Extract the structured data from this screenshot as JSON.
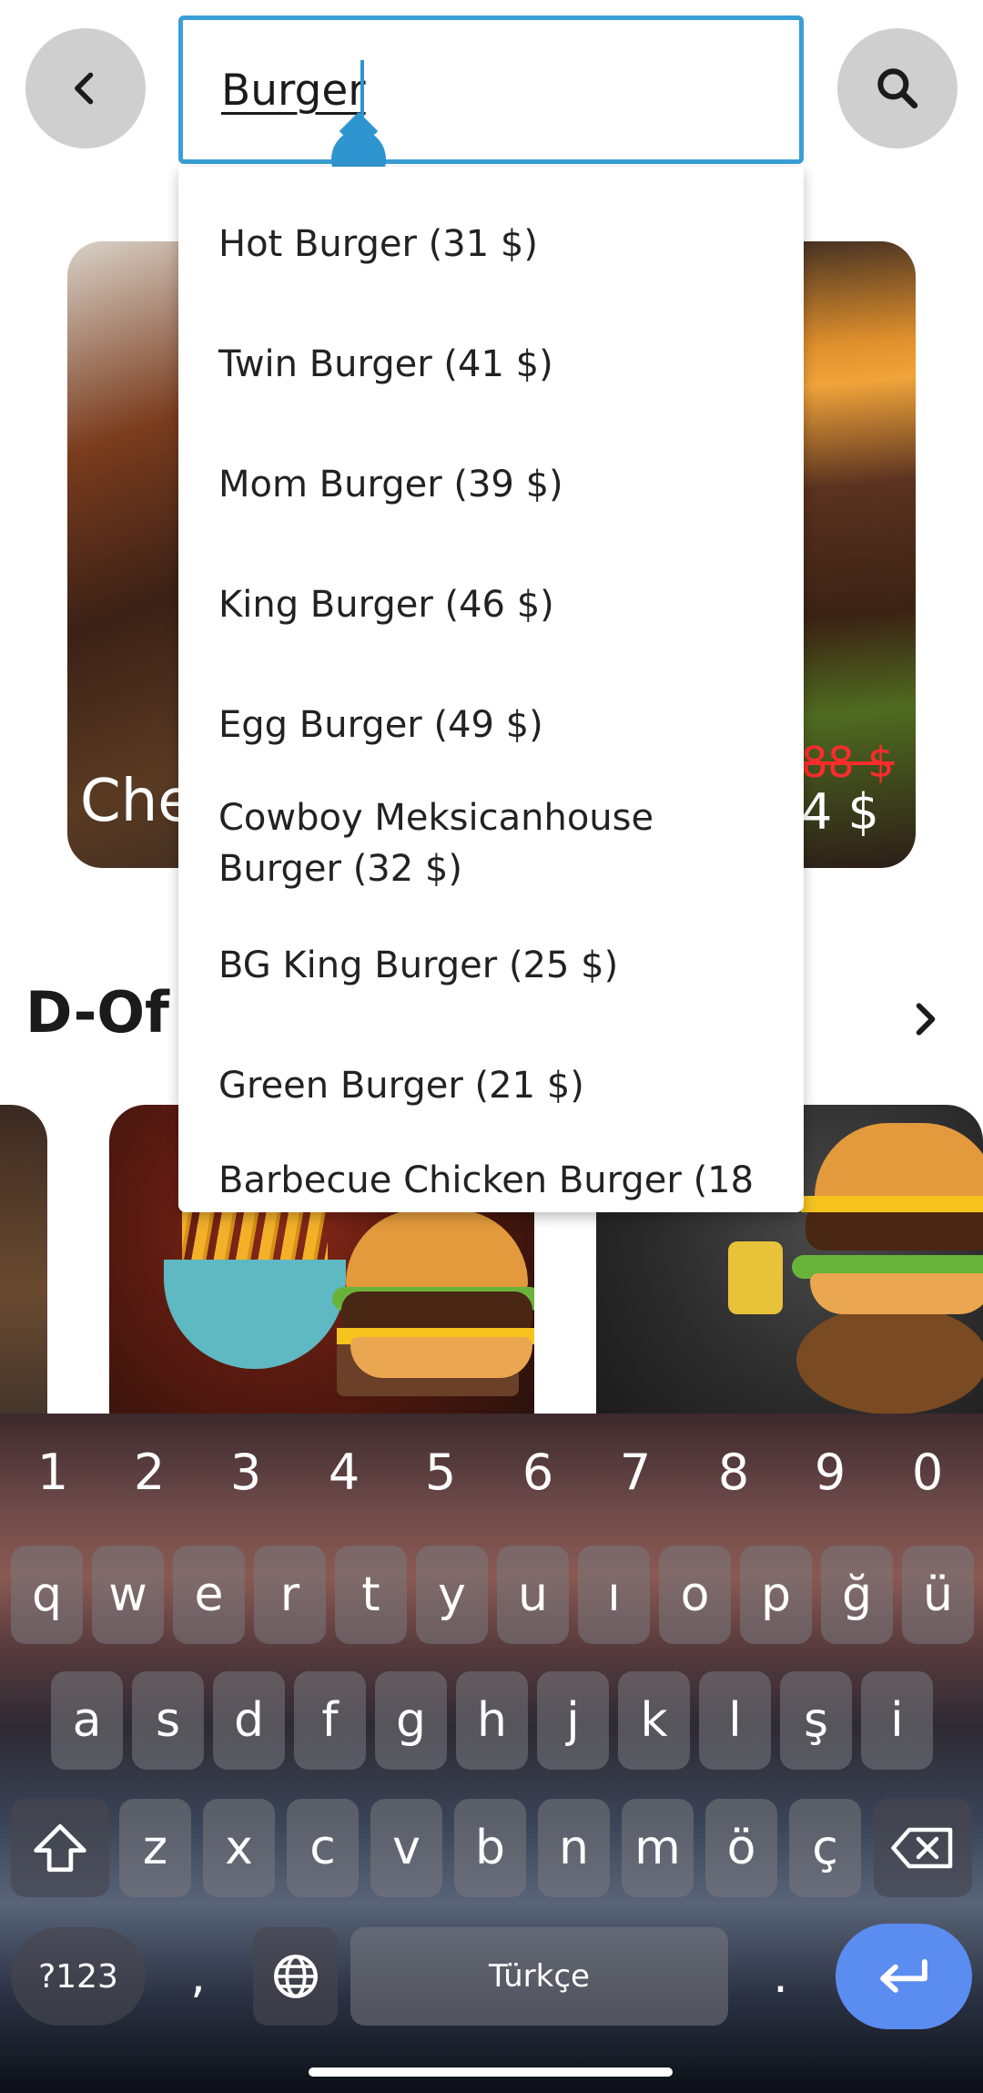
{
  "header": {
    "back_icon": "chevron-left-icon",
    "search_icon": "search-icon",
    "search_value": "Burger"
  },
  "featured": {
    "left_card_title": "Che",
    "right_card_old_price": "88 $",
    "right_card_price": "4 $"
  },
  "section": {
    "title": "D-Of",
    "more_icon": "chevron-right-icon"
  },
  "suggestions": [
    "Hot Burger (31 $)",
    "Twin Burger (41 $)",
    "Mom Burger (39 $)",
    "King Burger (46 $)",
    "Egg Burger (49 $)",
    "Cowboy Meksicanhouse Burger (32 $)",
    "BG King Burger (25 $)",
    "Green Burger (21 $)",
    "Barbecue Chicken Burger (18"
  ],
  "keyboard": {
    "numbers": [
      "1",
      "2",
      "3",
      "4",
      "5",
      "6",
      "7",
      "8",
      "9",
      "0"
    ],
    "row1": [
      "q",
      "w",
      "e",
      "r",
      "t",
      "y",
      "u",
      "ı",
      "o",
      "p",
      "ğ",
      "ü"
    ],
    "row2": [
      "a",
      "s",
      "d",
      "f",
      "g",
      "h",
      "j",
      "k",
      "l",
      "ş",
      "i"
    ],
    "row3": [
      "z",
      "x",
      "c",
      "v",
      "b",
      "n",
      "m",
      "ö",
      "ç"
    ],
    "symbols_label": "?123",
    "comma": ",",
    "space_label": "Türkçe",
    "period": ".",
    "shift_icon": "shift-icon",
    "backspace_icon": "backspace-icon",
    "globe_icon": "globe-icon",
    "enter_icon": "enter-icon",
    "enter_color": "#5b8cf0"
  },
  "colors": {
    "accent": "#3b9ed4",
    "strike_price": "#ff2c2c"
  }
}
